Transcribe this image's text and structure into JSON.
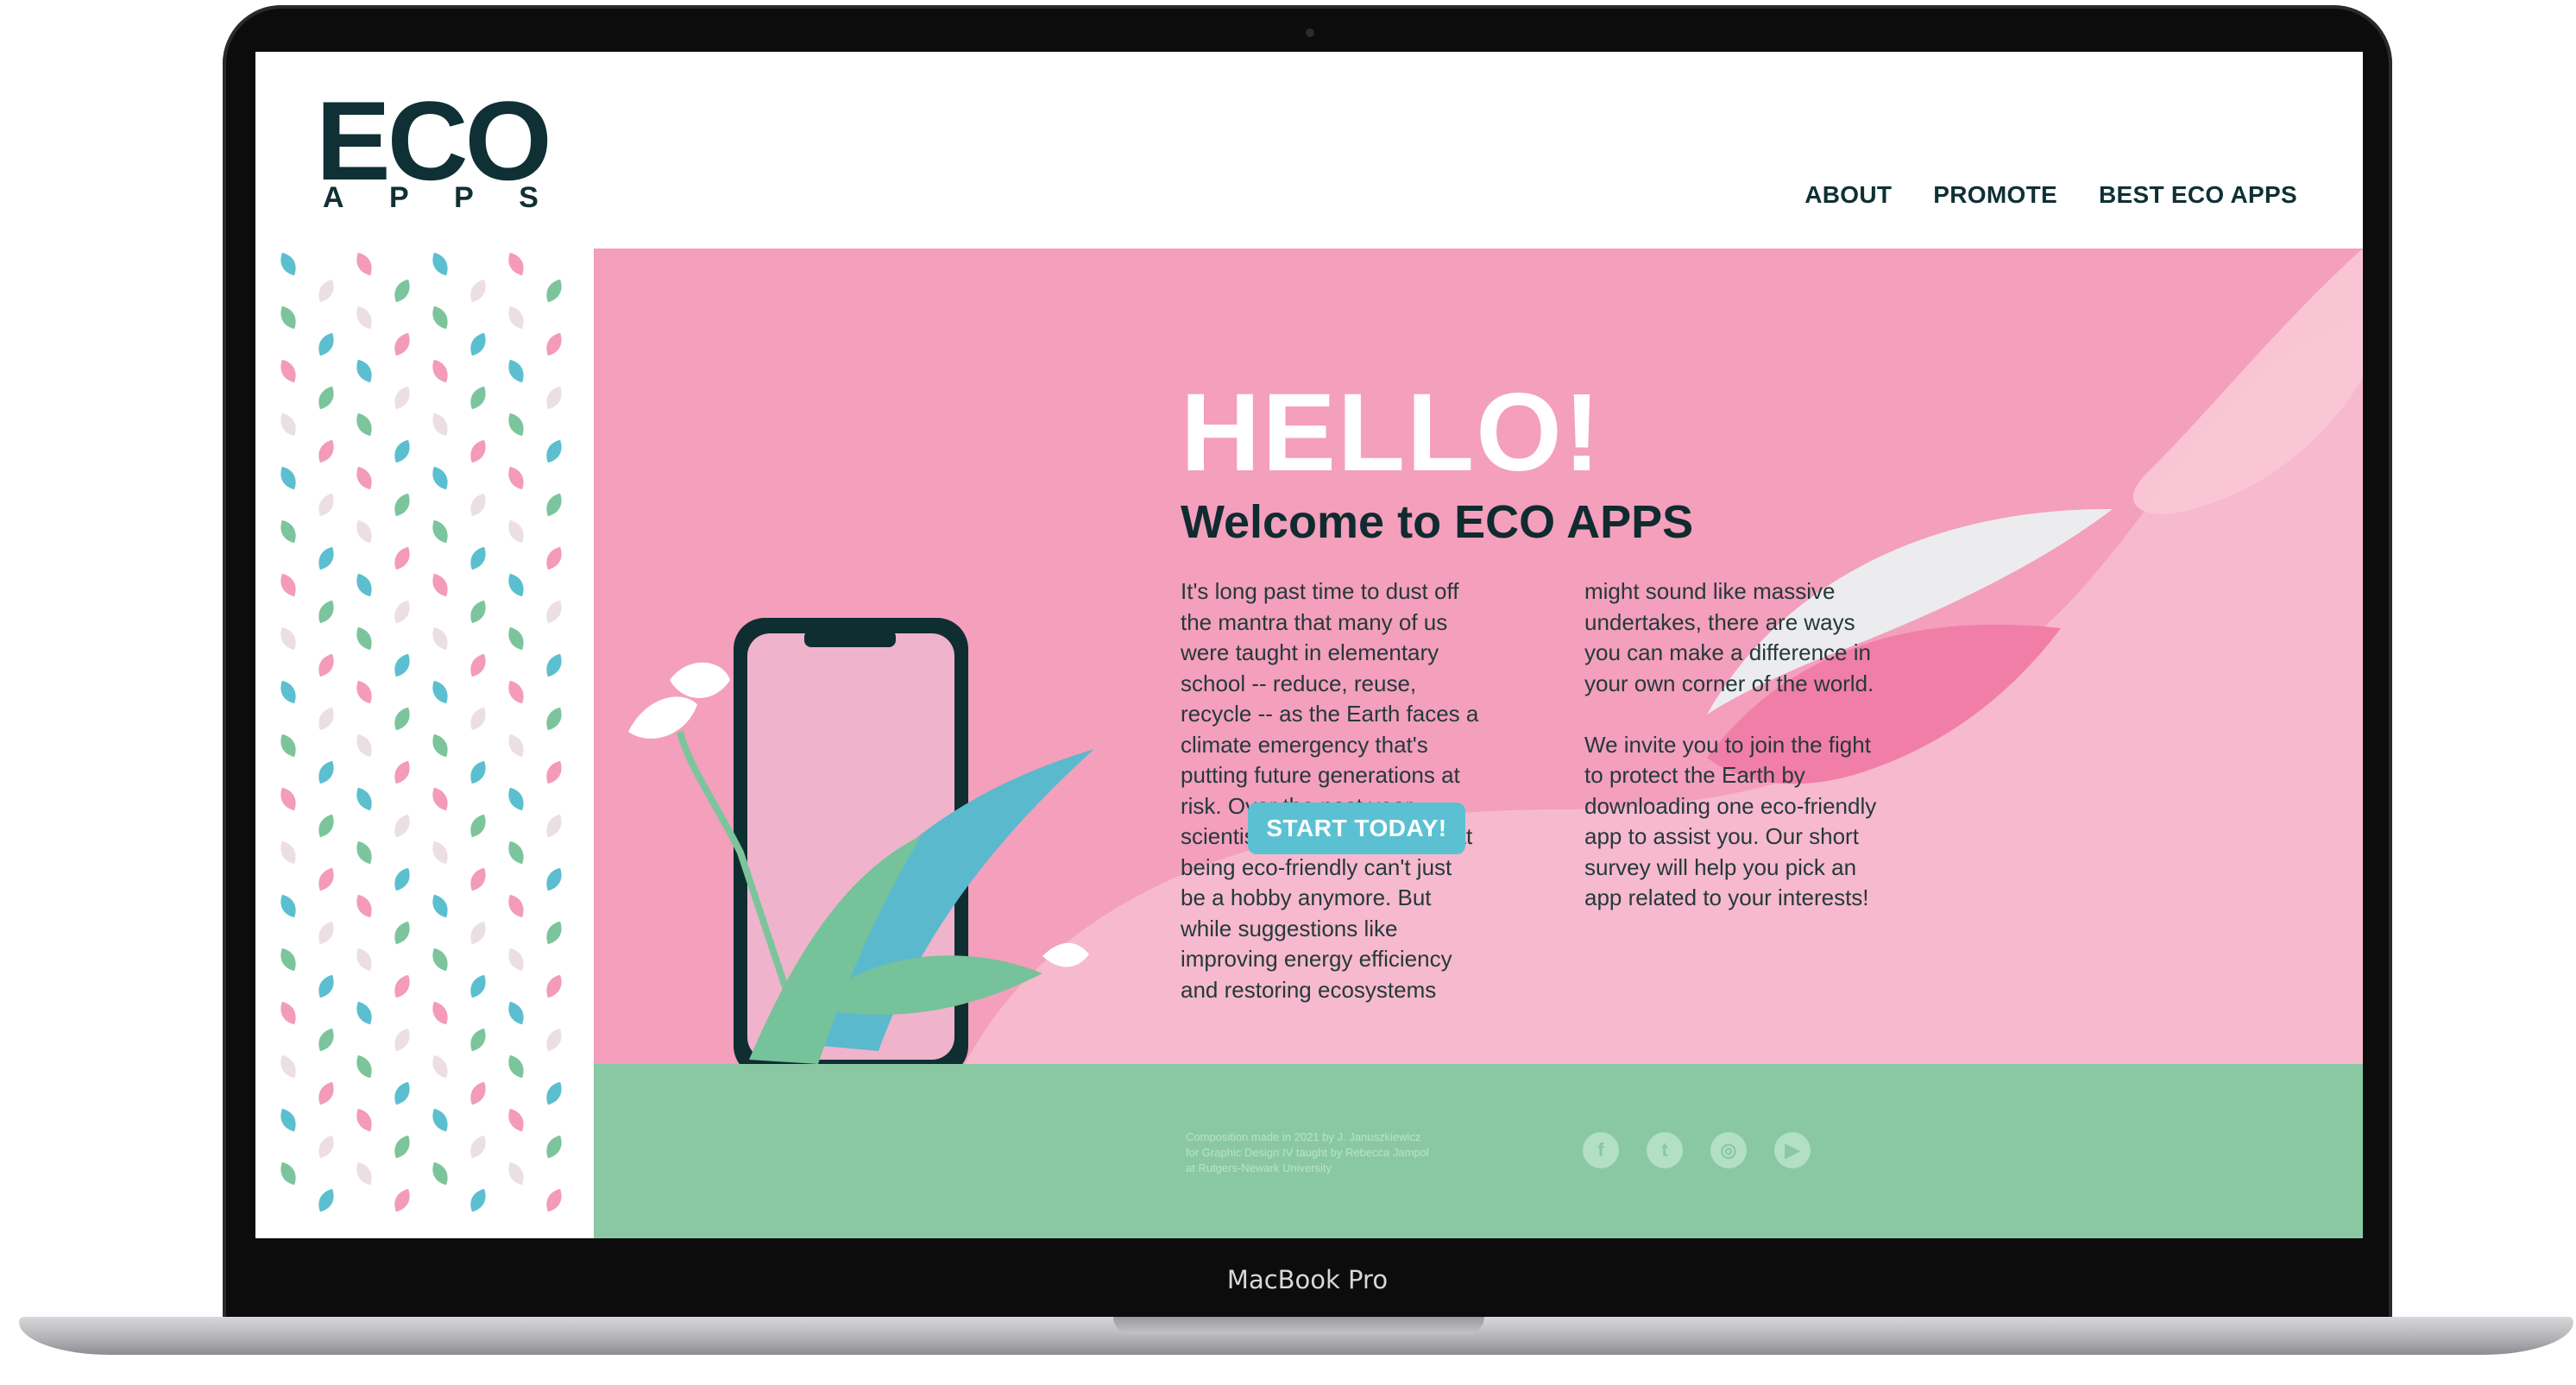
{
  "laptop": {
    "model_label": "MacBook Pro"
  },
  "logo": {
    "main": "ECO",
    "letters": [
      "A",
      "P",
      "P",
      "S"
    ]
  },
  "nav": {
    "items": [
      "ABOUT",
      "PROMOTE",
      "BEST ECO APPS"
    ]
  },
  "hero": {
    "title": "HELLO!",
    "subtitle": "Welcome to ECO APPS",
    "col1": "It's long past time to dust off\nthe mantra that many of us\nwere taught in elementary\nschool -- reduce, reuse,\nrecycle -- as the Earth faces a\nclimate emergency that's\nputting future generations at\nrisk. Over the past year,\nscientists have reiterated that\nbeing eco-friendly can't just\nbe a hobby anymore. But\nwhile suggestions like\nimproving energy efficiency\nand restoring ecosystems",
    "col2": "might sound like massive\nundertakes, there are ways\nyou can make a difference in\nyour own corner of the world.\n\nWe invite you to join the fight\nto protect the Earth by\ndownloading one eco-friendly\napp to assist you. Our short\nsurvey will help you pick an\napp related to your interests!",
    "cta_label": "START TODAY!"
  },
  "footer": {
    "credit": "Composition made in 2021 by J. Januszkiewicz\nfor Graphic Design IV taught by Rebecca Jampol\nat Rutgers-Newark University",
    "social": [
      {
        "icon": "facebook-icon",
        "glyph": "f"
      },
      {
        "icon": "twitter-icon",
        "glyph": "t"
      },
      {
        "icon": "instagram-icon",
        "glyph": "◎"
      },
      {
        "icon": "youtube-icon",
        "glyph": "▶"
      }
    ]
  },
  "colors": {
    "hero_pink": "#f49fbc",
    "footer_green": "#8ac8a4",
    "accent_teal": "#5bc1d2",
    "logo_dark": "#0f3034"
  }
}
